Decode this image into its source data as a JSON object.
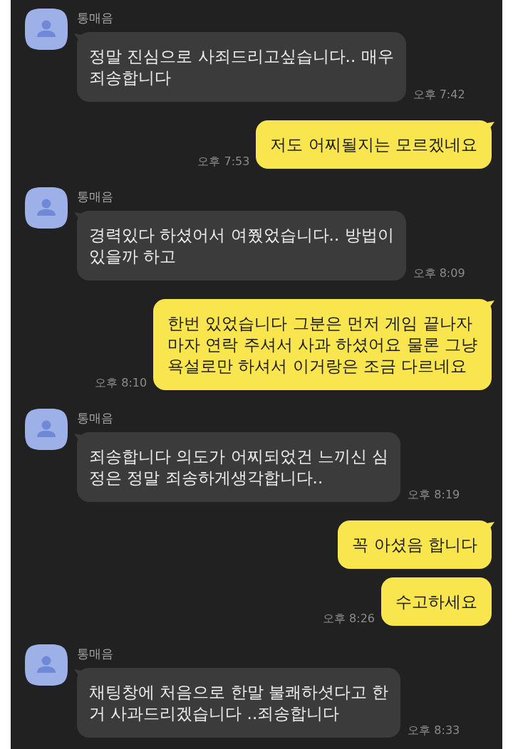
{
  "messages": [
    {
      "kind": "incoming",
      "sender": "통매음",
      "text": "정말 진심으로 사죄드리고싶습니다.. 매우\n죄송합니다",
      "time": "오후 7:42"
    },
    {
      "kind": "outgoing",
      "text": "저도 어찌될지는 모르겠네요",
      "time": "오후 7:53"
    },
    {
      "kind": "incoming",
      "sender": "통매음",
      "text": "경력있다 하셨어서 여쭸었습니다.. 방법이\n있을까 하고",
      "time": "오후 8:09"
    },
    {
      "kind": "outgoing",
      "text": "한번 있었습니다 그분은 먼저 게임 끝나자\n마자 연락 주셔서 사과 하셨어요 물론 그냥\n욕설로만 하셔서 이거랑은 조금 다르네요",
      "time": "오후 8:10"
    },
    {
      "kind": "incoming",
      "sender": "통매음",
      "text": "죄송합니다 의도가 어찌되었건 느끼신 심\n정은 정말 죄송하게생각합니다..",
      "time": "오후 8:19"
    },
    {
      "kind": "outgoing",
      "text": "꼭 아셨음 합니다"
    },
    {
      "kind": "outgoing",
      "text": "수고하세요",
      "time": "오후 8:26"
    },
    {
      "kind": "incoming",
      "sender": "통매음",
      "text": "채팅창에 처음으로 한말 불쾌하셧다고 한\n거 사과드리겠습니다 ..죄송합니다",
      "time": "오후 8:33"
    }
  ]
}
